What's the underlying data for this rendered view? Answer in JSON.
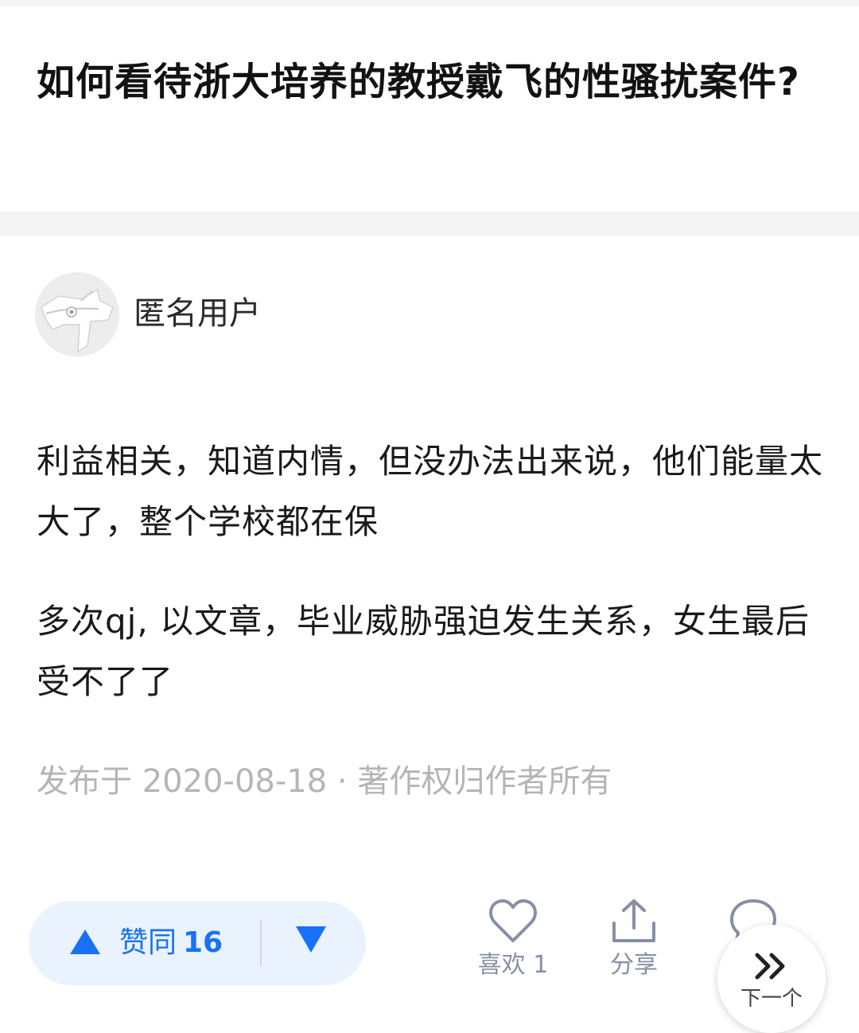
{
  "question": {
    "title": "如何看待浙大培养的教授戴飞的性骚扰案件?"
  },
  "answer": {
    "author": "匿名用户",
    "paragraphs": [
      "利益相关，知道内情，但没办法出来说，他们能量太大了，整个学校都在保",
      "多次qj, 以文章，毕业威胁强迫发生关系，女生最后受不了了"
    ],
    "meta": "发布于 2020-08-18 · 著作权归作者所有"
  },
  "actions": {
    "vote_up_label": "赞同",
    "vote_up_count": "16",
    "like_label": "喜欢 1",
    "share_label": "分享",
    "next_label": "下一个"
  },
  "colors": {
    "accent": "#1772f6",
    "vote_bg": "#eaf2fd",
    "muted": "#b5b5b5",
    "icon_gray": "#8590a6"
  },
  "icons": [
    "anonymous-avatar",
    "arrow-up-icon",
    "arrow-down-icon",
    "heart-icon",
    "share-icon",
    "comment-icon",
    "double-chevron-right-icon"
  ]
}
